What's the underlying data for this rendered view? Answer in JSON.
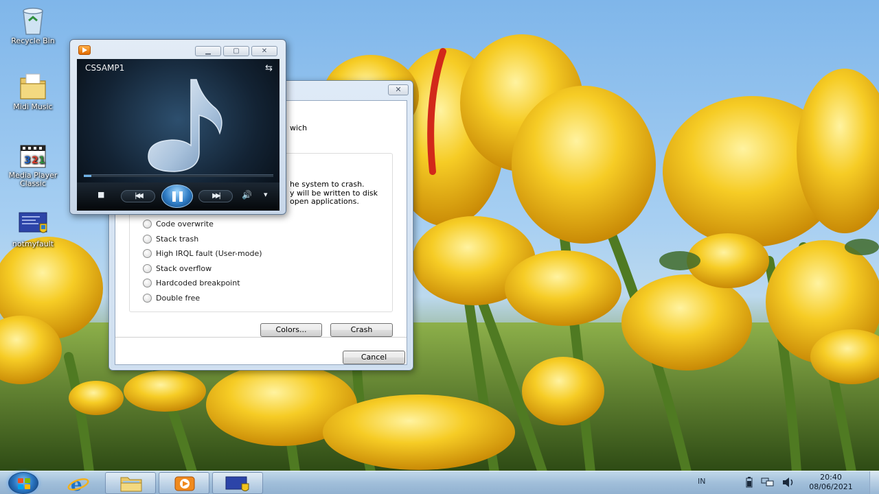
{
  "desktop": {
    "icons": [
      {
        "label": "Recycle Bin",
        "icon": "recycle-bin-icon"
      },
      {
        "label": "Midi Music",
        "icon": "folder-icon"
      },
      {
        "label": "Media Player Classic",
        "icon": "media-player-classic-icon"
      },
      {
        "label": "notmyfault",
        "icon": "notmyfault-icon"
      }
    ]
  },
  "dialog": {
    "close_label": "✕",
    "header_fragment": "wich",
    "description_lines": [
      "he system to crash.",
      "y will be written to disk",
      "open applications."
    ],
    "options": [
      {
        "label": "Code overwrite",
        "selected": false
      },
      {
        "label": "Stack trash",
        "selected": false
      },
      {
        "label": "High IRQL fault (User-mode)",
        "selected": false
      },
      {
        "label": "Stack overflow",
        "selected": false
      },
      {
        "label": "Hardcoded breakpoint",
        "selected": false
      },
      {
        "label": "Double free",
        "selected": false
      }
    ],
    "colors_button": "Colors...",
    "crash_button": "Crash",
    "cancel_button": "Cancel"
  },
  "player": {
    "title": "CSSAMP1",
    "minimize_label": "▁",
    "maximize_label": "▢",
    "close_label": "✕",
    "stop_label": "■",
    "prev_label": "|◀◀",
    "next_label": "▶▶|",
    "volume_label": "🔊",
    "volume_menu_label": "▾",
    "switch_view_label": "⇆",
    "progress_fraction": 0.04
  },
  "taskbar": {
    "pinned": [
      {
        "name": "internet-explorer",
        "icon": "internet-explorer-icon"
      },
      {
        "name": "windows-explorer",
        "icon": "folder-icon"
      },
      {
        "name": "windows-media-player",
        "icon": "media-player-icon"
      },
      {
        "name": "notmyfault",
        "icon": "notmyfault-icon"
      }
    ],
    "tray": {
      "language": "IN",
      "time": "20:40",
      "date": "08/06/2021"
    }
  },
  "colors": {
    "accent": "#2f7cc4",
    "tulip": "#f2c31c",
    "sky": "#8bbfed"
  }
}
